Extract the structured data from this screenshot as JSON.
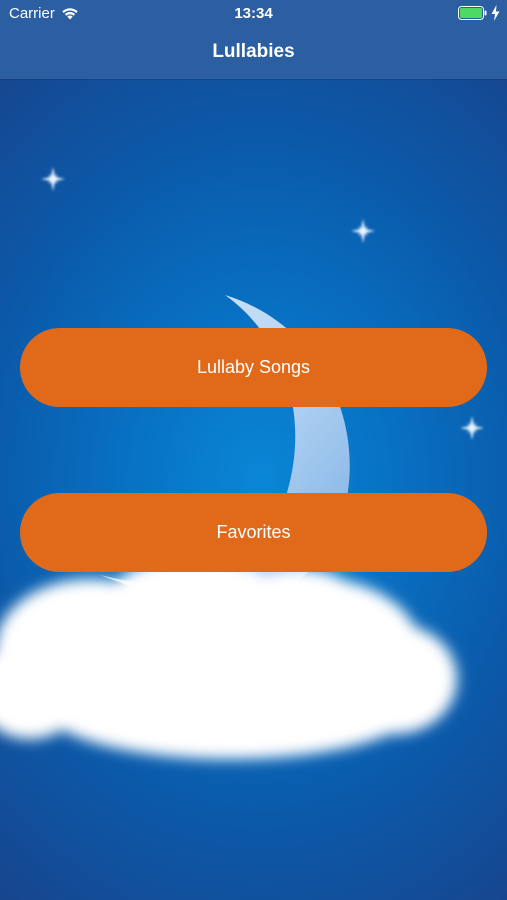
{
  "status_bar": {
    "carrier": "Carrier",
    "time": "13:34",
    "battery_color": "#4cd964"
  },
  "nav": {
    "title": "Lullabies",
    "bar_color": "#2c5ea2"
  },
  "menu": {
    "songs_label": "Lullaby Songs",
    "favorites_label": "Favorites",
    "button_color": "#e16a1a"
  },
  "background": {
    "icons": [
      "star-icon",
      "moon-icon",
      "cloud-icon"
    ],
    "sky_color": "#0872c4"
  }
}
